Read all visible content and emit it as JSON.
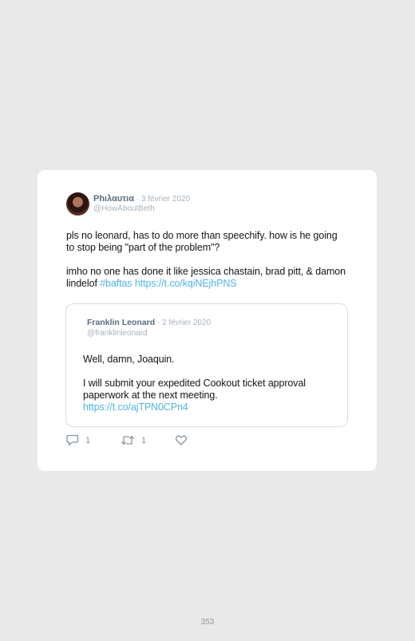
{
  "tweet": {
    "author_name": "Ρhιλαυτια",
    "separator": " · ",
    "date": "3 février 2020",
    "handle": "@HowAboutBeth",
    "paragraph1": "pls no leonard, has to do more than speechify. how is he going to stop being \"part of the problem\"?",
    "paragraph2_text": "imho no one has done it like jessica chastain, brad pitt, & damon lindelof ",
    "hashtag": "#baftas",
    "link": "https://t.co/kqiNEjhPNS"
  },
  "quote": {
    "author_name": "Franklin Leonard",
    "separator": " · ",
    "date": "2 février 2020",
    "handle": "@franklinleonard",
    "paragraph1": "Well, damn, Joaquin.",
    "paragraph2": "I will submit your expedited Cookout ticket approval paperwork at the next meeting.",
    "link": "https://t.co/ajTPN0CPn4"
  },
  "actions": {
    "reply_count": "1",
    "retweet_count": "1",
    "icon_reply": "reply-icon",
    "icon_retweet": "retweet-icon",
    "icon_like": "like-icon"
  },
  "page_number": "353",
  "colors": {
    "link": "#4fb4ea",
    "muted": "#a7b3bd",
    "author": "#5b6d7c",
    "background": "#e9e9e9"
  }
}
